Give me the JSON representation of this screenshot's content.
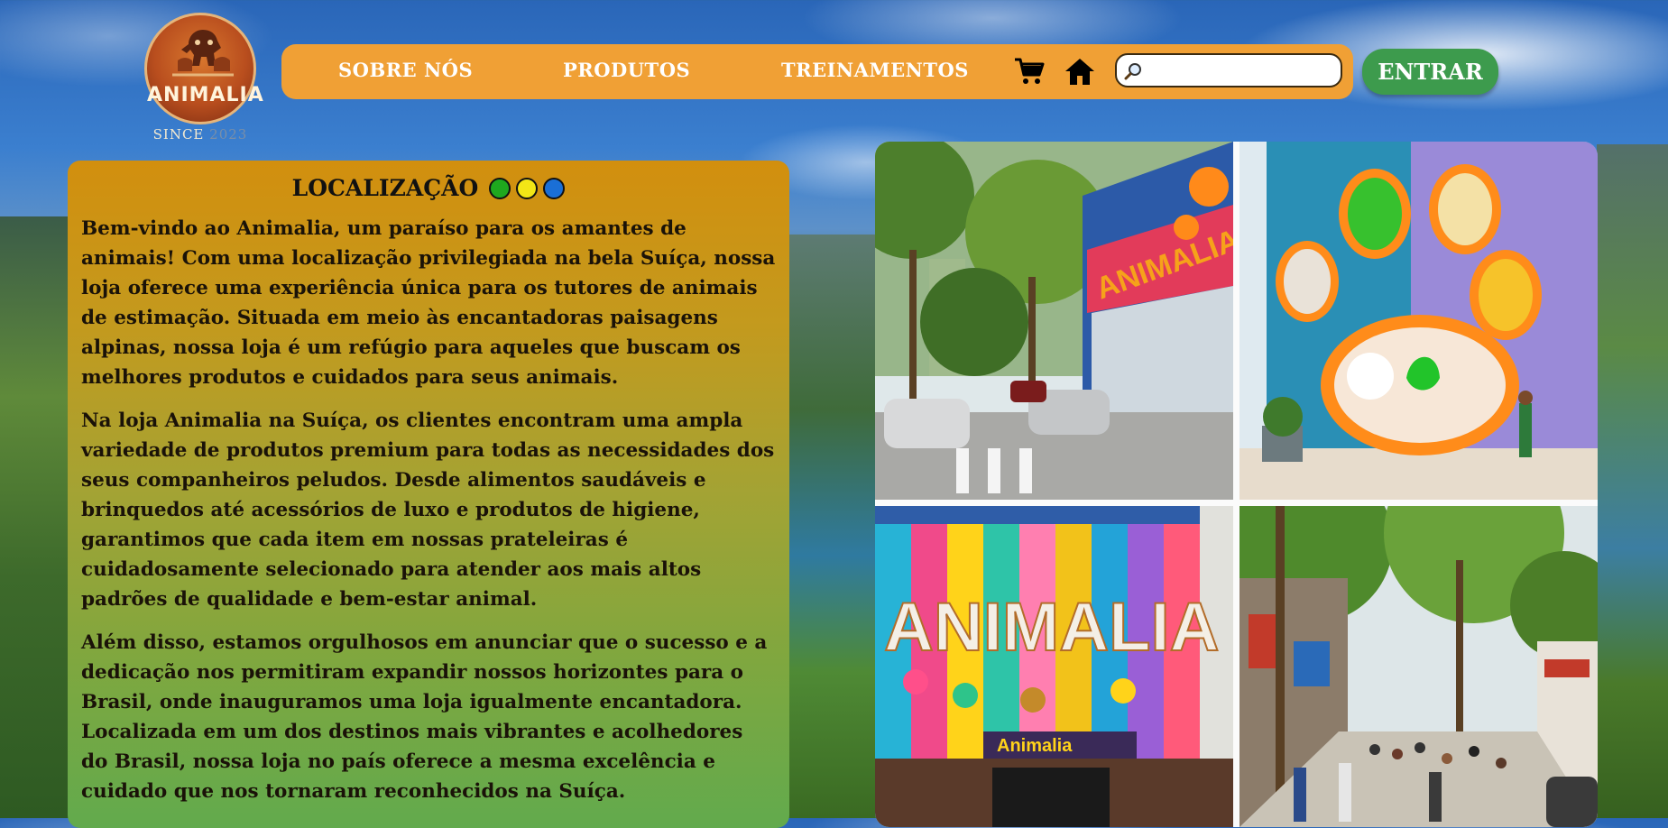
{
  "logo": {
    "name": "ANIMALIA",
    "since_label": "SINCE",
    "since_year": "2023"
  },
  "nav": {
    "links": [
      "SOBRE NÓS",
      "PRODUTOS",
      "TREINAMENTOS"
    ],
    "cart_icon": "cart-icon",
    "home_icon": "home-icon",
    "search_icon": "search-icon",
    "search_value": "",
    "login_label": "ENTRAR"
  },
  "panel": {
    "title": "LOCALIZAÇÃO",
    "dots": [
      "#1ea81e",
      "#f2e616",
      "#1a6fd6"
    ],
    "paragraphs": [
      "Bem-vindo ao Animalia, um paraíso para os amantes de animais! Com uma localização privilegiada na bela Suíça, nossa loja oferece uma experiência única para os tutores de animais de estimação. Situada em meio às encantadoras paisagens alpinas, nossa loja é um refúgio para aqueles que buscam os melhores produtos e cuidados para seus animais.",
      "Na loja Animalia na Suíça, os clientes encontram uma ampla variedade de produtos premium para todas as necessidades dos seus companheiros peludos. Desde alimentos saudáveis e brinquedos até acessórios de luxo e produtos de higiene, garantimos que cada item em nossas prateleiras é cuidadosamente selecionado para atender aos mais altos padrões de qualidade e bem-estar animal.",
      "Além disso, estamos orgulhosos em anunciar que o sucesso e a dedicação nos permitiram expandir nossos horizontes para o Brasil, onde inauguramos uma loja igualmente encantadora. Localizada em um dos destinos mais vibrantes e acolhedores do Brasil, nossa loja no país oferece a mesma excelência e cuidado que nos tornaram reconhecidos na Suíça."
    ]
  },
  "gallery": {
    "sign_1": "ANIMALIA",
    "sign_3": "ANIMALIA",
    "sign_3_small": "Animalia"
  }
}
